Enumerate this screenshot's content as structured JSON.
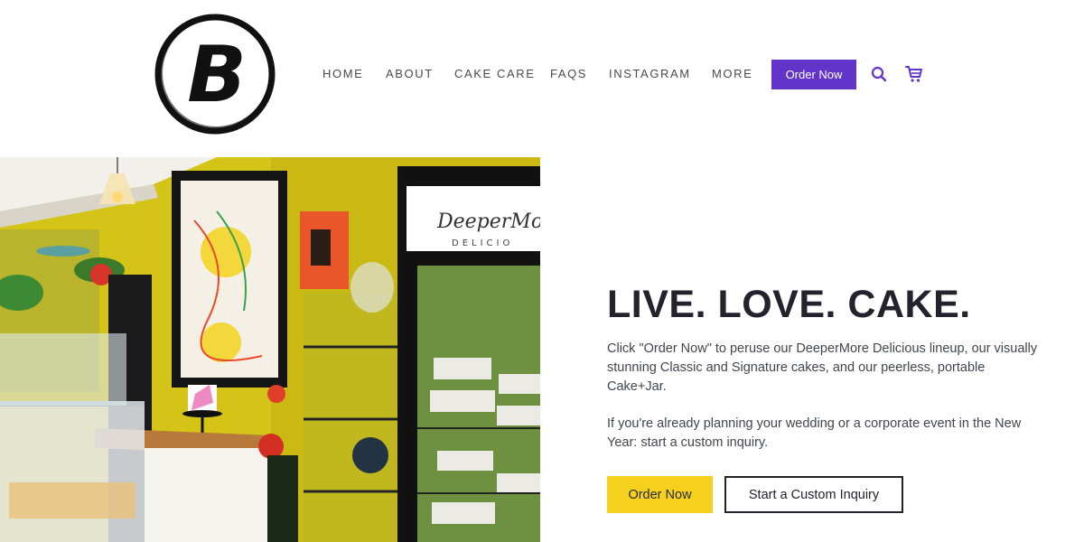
{
  "brand": {
    "logo_letter": "B"
  },
  "nav": {
    "items": [
      "HOME",
      "ABOUT",
      "CAKE CARE",
      "FAQS",
      "INSTAGRAM",
      "MORE"
    ],
    "order_button": "Order Now",
    "search_icon": "search-icon",
    "cart_icon": "cart-icon"
  },
  "hero": {
    "title": "LIVE. LOVE. CAKE.",
    "paragraph_1": "Click \"Order Now\" to peruse our DeeperMore Delicious lineup, our visually stunning Classic and Signature cakes, and our peerless, portable Cake+Jar.",
    "paragraph_2": "If you're already planning your wedding or a corporate event in the New Year: start a custom inquiry.",
    "order_button": "Order Now",
    "inquiry_button": "Start a Custom Inquiry",
    "photo_sign": "DeeperMore",
    "photo_sign_sub": "DELICIO"
  },
  "colors": {
    "accent_purple": "#6234c9",
    "accent_yellow": "#f5d11e",
    "text_dark": "#24222d"
  }
}
